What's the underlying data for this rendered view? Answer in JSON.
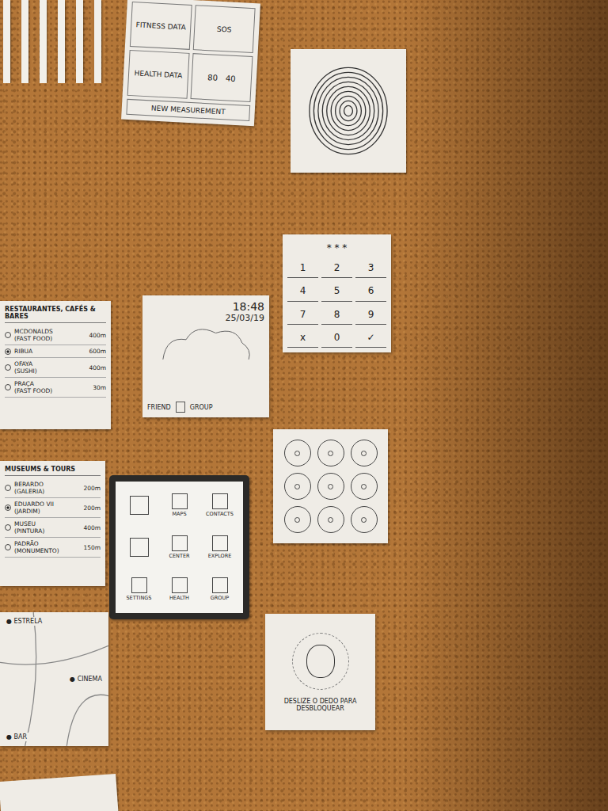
{
  "board": {
    "kind": "corkboard"
  },
  "cards": [
    {
      "kind": "strips",
      "count": 6
    },
    {
      "kind": "menu",
      "cells": [
        "FITNESS DATA",
        "SOS",
        "HEALTH DATA"
      ],
      "values": [
        "80",
        "40"
      ],
      "footer": "NEW MEASUREMENT"
    },
    {
      "kind": "fingerprint"
    },
    {
      "kind": "keypad",
      "masked": "* * *",
      "keys": [
        "1",
        "2",
        "3",
        "4",
        "5",
        "6",
        "7",
        "8",
        "9",
        "x",
        "0",
        "✓"
      ]
    },
    {
      "kind": "list",
      "title": "RESTAURANTES, CAFÉS & BARES",
      "rows": [
        {
          "name": "MCDONALDS",
          "sub": "(FAST FOOD)",
          "distance": "400m",
          "selected": false
        },
        {
          "name": "RIBUA",
          "sub": "",
          "distance": "600m",
          "selected": true
        },
        {
          "name": "OFAYA",
          "sub": "(SUSHI)",
          "distance": "400m",
          "selected": false
        },
        {
          "name": "PRAÇA",
          "sub": "(FAST FOOD)",
          "distance": "30m",
          "selected": false
        }
      ]
    },
    {
      "kind": "lockscreen",
      "time": "18:48",
      "date": "25/03/19",
      "friend": "FRIEND",
      "group": "GROUP"
    },
    {
      "kind": "pattern",
      "dots": 9
    },
    {
      "kind": "list",
      "title": "MUSEUMS & TOURS",
      "rows": [
        {
          "name": "BERARDO",
          "sub": "(GALERIA)",
          "distance": "200m",
          "selected": false
        },
        {
          "name": "EDUARDO VII",
          "sub": "(JARDIM)",
          "distance": "200m",
          "selected": true
        },
        {
          "name": "MUSEU",
          "sub": "(PINTURA)",
          "distance": "400m",
          "selected": false
        },
        {
          "name": "PADRÃO",
          "sub": "(MONUMENTO)",
          "distance": "150m",
          "selected": false
        }
      ]
    },
    {
      "kind": "phone",
      "apps": [
        {
          "kind": "empty",
          "label": ""
        },
        {
          "kind": "app",
          "label": "MAPS"
        },
        {
          "kind": "app",
          "label": "CONTACTS"
        },
        {
          "kind": "empty",
          "label": ""
        },
        {
          "kind": "app",
          "label": "CENTER"
        },
        {
          "kind": "app",
          "label": "EXPLORE"
        },
        {
          "kind": "app",
          "label": "SETTINGS"
        },
        {
          "kind": "app",
          "label": "HEALTH"
        },
        {
          "kind": "app",
          "label": "GROUP"
        }
      ]
    },
    {
      "kind": "map",
      "labels": [
        "ESTRELA",
        "CINEMA",
        "BAR"
      ]
    },
    {
      "kind": "unlock",
      "text": "DESLIZE O DEDO PARA DESBLOQUEAR"
    },
    {
      "kind": "blank"
    }
  ]
}
